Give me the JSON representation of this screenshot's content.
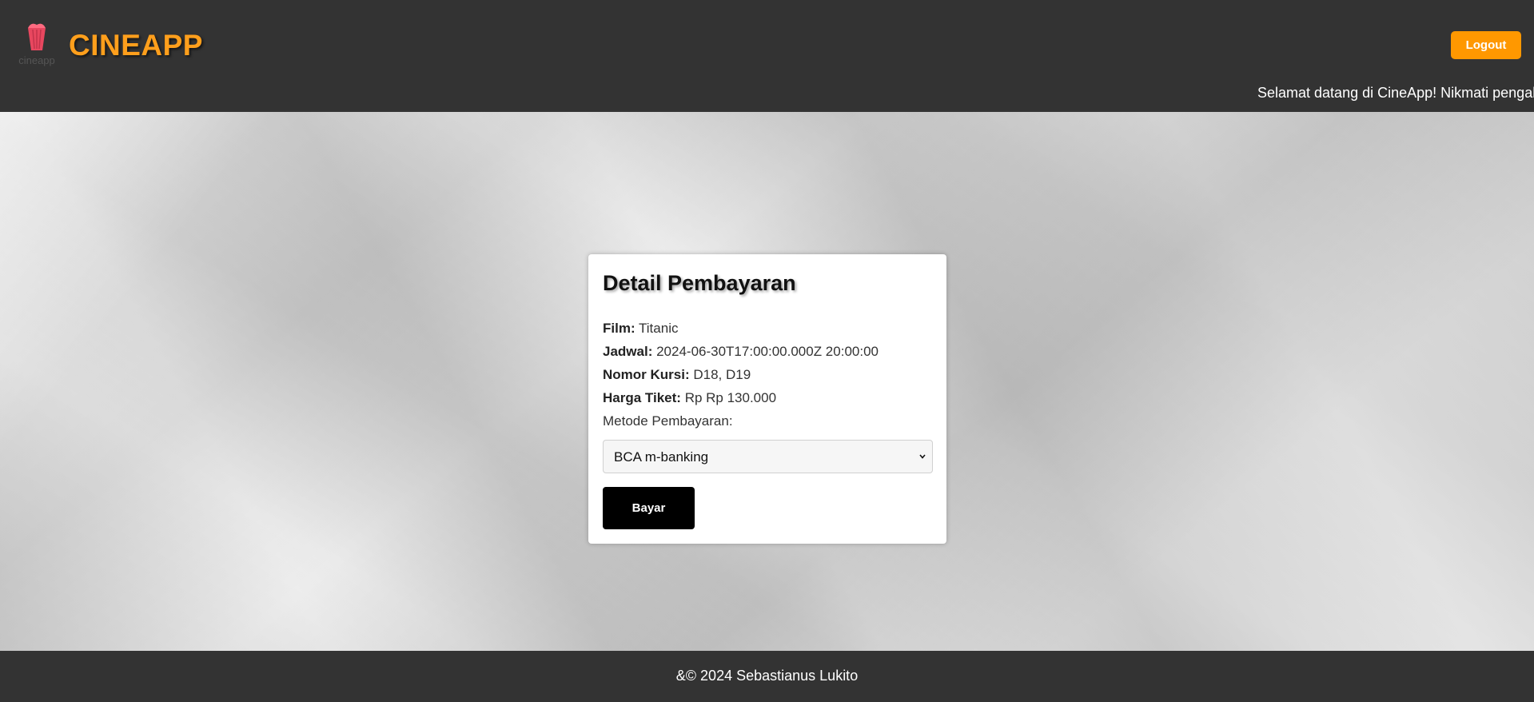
{
  "header": {
    "brand": "CINEAPP",
    "logo_text": "cineapp",
    "logout_label": "Logout",
    "marquee": "Selamat datang di CineApp! Nikmati pengal"
  },
  "payment": {
    "title": "Detail Pembayaran",
    "film_label": "Film:",
    "film_value": "Titanic",
    "jadwal_label": "Jadwal:",
    "jadwal_value": "2024-06-30T17:00:00.000Z 20:00:00",
    "kursi_label": "Nomor Kursi:",
    "kursi_value": "D18, D19",
    "harga_label": "Harga Tiket:",
    "harga_value": "Rp Rp 130.000",
    "method_label": "Metode Pembayaran:",
    "method_selected": "BCA m-banking",
    "pay_label": "Bayar"
  },
  "footer": {
    "copyright": "&© 2024 Sebastianus Lukito"
  },
  "colors": {
    "header_bg": "#333333",
    "brand": "#ff9f1c",
    "logout_bg": "#ff9800",
    "pay_bg": "#000000"
  }
}
